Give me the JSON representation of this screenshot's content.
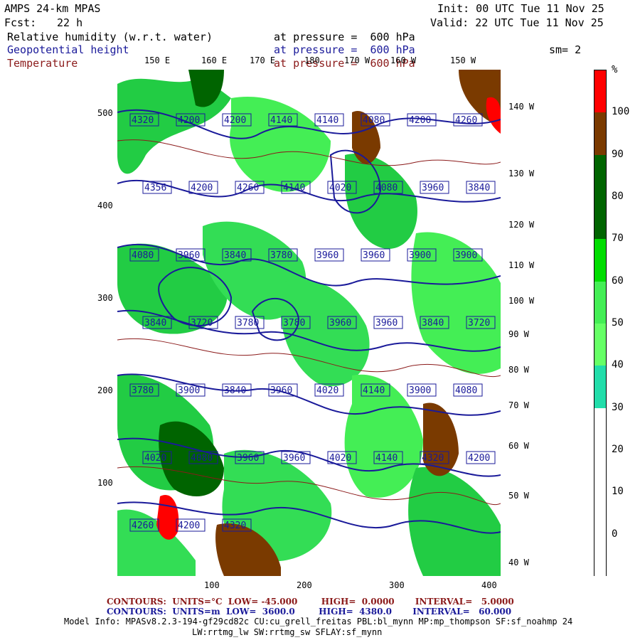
{
  "header": {
    "model": "AMPS 24-km MPAS",
    "fcst_label": "Fcst:",
    "fcst_value": "22 h",
    "init": "Init: 00 UTC Tue 11 Nov 25",
    "valid": "Valid: 22 UTC Tue 11 Nov 25",
    "smoothing": "sm= 2"
  },
  "fields": [
    {
      "name": "Relative humidity (w.r.t. water)",
      "level": "at pressure =  600 hPa",
      "color": "#000000"
    },
    {
      "name": "Geopotential height",
      "level": "at pressure =  600 hPa",
      "color": "#1a1a9a"
    },
    {
      "name": "Temperature",
      "level": "at pressure =  600 hPa",
      "color": "#8b1a1a"
    }
  ],
  "map": {
    "x_ticks": [
      "100",
      "200",
      "300",
      "400"
    ],
    "y_ticks": [
      "100",
      "200",
      "300",
      "400",
      "500"
    ],
    "top_lon_labels": [
      "150 E",
      "160 E",
      "170 E",
      "180",
      "170 W",
      "160 W",
      "150 W"
    ],
    "right_lon_labels": [
      "140 W",
      "130 W",
      "120 W",
      "110 W",
      "100 W",
      "90 W",
      "80 W",
      "70 W",
      "60 W",
      "50 W",
      "40 W"
    ],
    "height_labels": [
      "4320",
      "4200",
      "4200",
      "4140",
      "4140",
      "4080",
      "4200",
      "4260",
      "4356",
      "4200",
      "4260",
      "4140",
      "4020",
      "4080",
      "3960",
      "3840",
      "4080",
      "3960",
      "3840",
      "3780",
      "3960",
      "3960",
      "3900",
      "3900",
      "3840",
      "3720",
      "3780",
      "3780",
      "3960",
      "3960",
      "3840",
      "3720",
      "3780",
      "3900",
      "3840",
      "3960",
      "4020",
      "4140",
      "3900",
      "4080",
      "4020",
      "4080",
      "3960",
      "3960",
      "4020",
      "4140",
      "4320",
      "4200",
      "4260",
      "4200",
      "4320"
    ]
  },
  "colorbar": {
    "unit": "%",
    "labels": [
      "100",
      "90",
      "80",
      "70",
      "60",
      "50",
      "40",
      "30",
      "20",
      "10",
      "0"
    ],
    "colors": [
      "#ff0000",
      "#7a3a00",
      "#006400",
      "#006400",
      "#00dd00",
      "#44ee55",
      "#66ff66",
      "#22ddaa",
      "#ffffff",
      "#ffffff",
      "#ffffff",
      "#ffffff"
    ]
  },
  "footer": {
    "temp_contours": "CONTOURS:  UNITS=°C  LOW= -45.000        HIGH=  0.0000       INTERVAL=   5.0000",
    "height_contours": "CONTOURS:  UNITS=m  LOW=  3600.0        HIGH=  4380.0       INTERVAL=   60.000",
    "model_info_1": "Model Info: MPASv8.2.3-194-gf29cd82c CU:cu_grell_freitas PBL:bl_mynn MP:mp_thompson SF:sf_noahmp 24",
    "model_info_2": "LW:rrtmg_lw SW:rrtmg_sw SFLAY:sf_mynn"
  }
}
